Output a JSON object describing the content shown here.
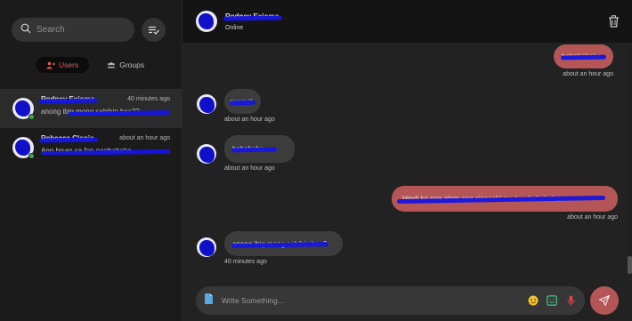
{
  "sidebar": {
    "search": {
      "placeholder": "Search"
    },
    "tabs": [
      {
        "label": "Users",
        "icon": "users-icon",
        "active": true
      },
      {
        "label": "Groups",
        "icon": "groups-icon",
        "active": false
      }
    ],
    "chats": [
      {
        "name": "Rodney Exiomo",
        "time": "40 minutes ago",
        "preview": "anong ibig mong sabihin bes??",
        "online": true,
        "selected": true
      },
      {
        "name": "Rebecca Clonis",
        "time": "about an hour ago",
        "preview": "Ang bisan sa fon nagbabaha",
        "online": true,
        "selected": false
      }
    ]
  },
  "header": {
    "name": "Rodney Exiomo",
    "status": "Online"
  },
  "messages": [
    {
      "dir": "out",
      "text": "hahahahaha",
      "time": "about an hour ago"
    },
    {
      "dir": "in",
      "text": "awwwit",
      "time": "about an hour ago"
    },
    {
      "dir": "in",
      "text": "hahahaha",
      "time": "about an hour ago",
      "heart": "♥"
    },
    {
      "dir": "out",
      "text": "Hindi ko nga alam ang sinasabi mo bes hahahaha",
      "time": "about an hour ago"
    },
    {
      "dir": "in",
      "text": "anong ibig mong sabihin bes?",
      "time": "40 minutes ago"
    }
  ],
  "compose": {
    "placeholder": "Write Something..."
  },
  "colors": {
    "accent": "#b55656",
    "redact": "#1414e0",
    "online": "#3ea84a"
  }
}
